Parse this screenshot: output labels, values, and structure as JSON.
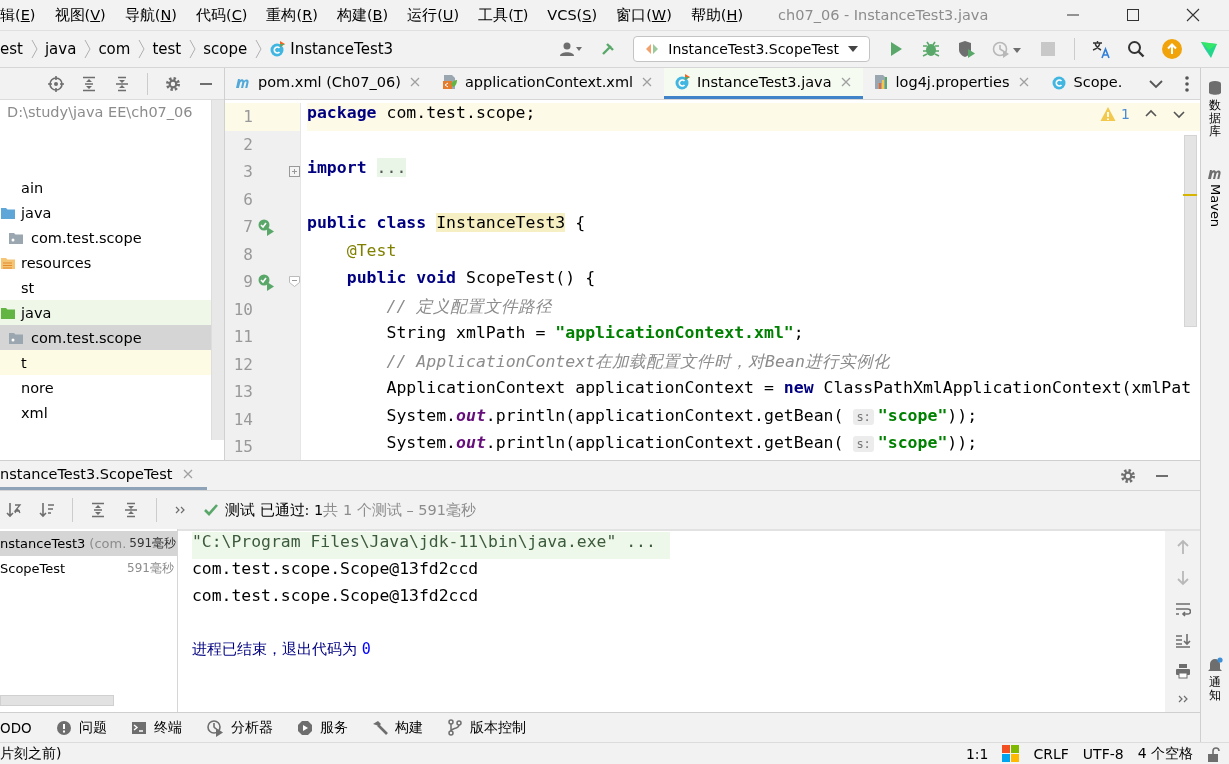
{
  "menu_bar": {
    "items": [
      "辑(E)",
      "视图(V)",
      "导航(N)",
      "代码(C)",
      "重构(R)",
      "构建(B)",
      "运行(U)",
      "工具(T)",
      "VCS(S)",
      "窗口(W)",
      "帮助(H)"
    ],
    "title": "ch07_06 - InstanceTest3.java"
  },
  "breadcrumbs": [
    {
      "label": "est",
      "kind": "folder"
    },
    {
      "label": "java",
      "kind": "folder"
    },
    {
      "label": "com",
      "kind": "folder"
    },
    {
      "label": "test",
      "kind": "folder"
    },
    {
      "label": "scope",
      "kind": "folder"
    },
    {
      "label": "InstanceTest3",
      "kind": "test-class"
    }
  ],
  "run_config": {
    "label": "InstanceTest3.ScopeTest"
  },
  "editor_tabs": [
    {
      "label": "pom.xml (Ch07_06)",
      "kind": "maven",
      "selected": false,
      "closable": true
    },
    {
      "label": "applicationContext.xml",
      "kind": "xml",
      "selected": false,
      "closable": true
    },
    {
      "label": "InstanceTest3.java",
      "kind": "test-class",
      "selected": true,
      "closable": true
    },
    {
      "label": "log4j.properties",
      "kind": "properties",
      "selected": false,
      "closable": true
    },
    {
      "label": "Scope.",
      "kind": "class",
      "selected": false,
      "closable": false
    }
  ],
  "project": {
    "path": "D:\\study\\java EE\\ch07_06",
    "tree": [
      {
        "label": "ain",
        "selected": false,
        "children": [
          {
            "label": "java",
            "kind": "source",
            "selected": false,
            "children": [
              {
                "label": "com.test.scope",
                "kind": "package",
                "selected": false
              }
            ]
          },
          {
            "label": "resources",
            "kind": "resources",
            "selected": false
          }
        ]
      },
      {
        "label": "st",
        "selected": false,
        "children": [
          {
            "label": "java",
            "kind": "test-source",
            "selected": false,
            "children": [
              {
                "label": "com.test.scope",
                "kind": "package",
                "selected": true
              }
            ]
          }
        ]
      },
      {
        "label": "t",
        "kind": "excluded",
        "selected": false
      },
      {
        "label": "nore",
        "selected": false
      },
      {
        "label": "xml",
        "selected": false
      }
    ]
  },
  "editor": {
    "warnings": "1",
    "lines": [
      {
        "number": "1",
        "current": true,
        "run_marker": false,
        "fold_marker": false,
        "tokens": [
          {
            "kind": "keyword",
            "text": "package"
          },
          {
            "kind": "plain",
            "text": " com.test.scope;"
          }
        ]
      },
      {
        "number": "2",
        "current": false,
        "run_marker": false,
        "fold_marker": false
      },
      {
        "number": "3",
        "current": false,
        "run_marker": false,
        "fold_marker": true,
        "folded": true,
        "tokens": [
          {
            "kind": "keyword",
            "text": "import "
          },
          {
            "kind": "folded",
            "text": "..."
          }
        ]
      },
      {
        "number": "6",
        "current": false,
        "run_marker": false,
        "fold_marker": false
      },
      {
        "number": "7",
        "current": false,
        "run_marker": true,
        "fold_marker": false,
        "tokens": [
          {
            "kind": "keyword",
            "text": "public class "
          },
          {
            "kind": "highlighted",
            "text": "InstanceTest3"
          },
          {
            "kind": "plain",
            "text": " {"
          }
        ]
      },
      {
        "number": "8",
        "current": false,
        "run_marker": false,
        "fold_marker": false,
        "tokens": [
          {
            "kind": "annotation",
            "text": "    @Test"
          }
        ]
      },
      {
        "number": "9",
        "current": false,
        "run_marker": true,
        "fold_marker": true,
        "folded": false,
        "tokens": [
          {
            "kind": "keyword",
            "text": "    public void"
          },
          {
            "kind": "plain",
            "text": " ScopeTest() {"
          }
        ]
      },
      {
        "number": "10",
        "current": false,
        "run_marker": false,
        "fold_marker": false,
        "tokens": [
          {
            "kind": "comment",
            "text": "        // 定义配置文件路径"
          }
        ]
      },
      {
        "number": "11",
        "current": false,
        "run_marker": false,
        "fold_marker": false,
        "tokens": [
          {
            "kind": "plain",
            "text": "        String xmlPath = "
          },
          {
            "kind": "string",
            "text": "\"applicationContext.xml\""
          },
          {
            "kind": "plain",
            "text": ";"
          }
        ]
      },
      {
        "number": "12",
        "current": false,
        "run_marker": false,
        "fold_marker": false,
        "tokens": [
          {
            "kind": "comment",
            "text": "        // ApplicationContext在加载配置文件时，对Bean进行实例化"
          }
        ]
      },
      {
        "number": "13",
        "current": false,
        "run_marker": false,
        "fold_marker": false,
        "tokens": [
          {
            "kind": "plain",
            "text": "        ApplicationContext applicationContext = "
          },
          {
            "kind": "keyword",
            "text": "new"
          },
          {
            "kind": "plain",
            "text": " ClassPathXmlApplicationContext(xmlPat"
          }
        ]
      },
      {
        "number": "14",
        "current": false,
        "run_marker": false,
        "fold_marker": false,
        "tokens": [
          {
            "kind": "plain",
            "text": "        System."
          },
          {
            "kind": "static",
            "text": "out"
          },
          {
            "kind": "plain",
            "text": ".println(applicationContext.getBean( "
          },
          {
            "kind": "hint",
            "text": "s:"
          },
          {
            "kind": "string",
            "text": " \"scope\""
          },
          {
            "kind": "plain",
            "text": "));"
          }
        ]
      },
      {
        "number": "15",
        "current": false,
        "run_marker": false,
        "fold_marker": false,
        "tokens": [
          {
            "kind": "plain",
            "text": "        System."
          },
          {
            "kind": "static",
            "text": "out"
          },
          {
            "kind": "plain",
            "text": ".println(applicationContext.getBean( "
          },
          {
            "kind": "hint",
            "text": "s:"
          },
          {
            "kind": "string",
            "text": " \"scope\""
          },
          {
            "kind": "plain",
            "text": "));"
          }
        ]
      }
    ]
  },
  "run_panel": {
    "tab": "nstanceTest3.ScopeTest",
    "passed": "测试 已通过: 1",
    "summary": "共 1 个测试 – 591毫秒",
    "tests": [
      {
        "label": "nstanceTest3",
        "detail": "(com.",
        "time": "591毫秒",
        "selected": true,
        "children": [
          {
            "label": "ScopeTest",
            "time": "591毫秒",
            "selected": false
          }
        ]
      }
    ],
    "console": [
      {
        "kind": "command",
        "text": "\"C:\\Program Files\\Java\\jdk-11\\bin\\java.exe\" ..."
      },
      {
        "kind": "output",
        "text": "com.test.scope.Scope@13fd2ccd"
      },
      {
        "kind": "output",
        "text": "com.test.scope.Scope@13fd2ccd"
      },
      {
        "kind": "exit",
        "text": "进程已结束，退出代码为 ",
        "code": "0"
      }
    ]
  },
  "tool_tabs": [
    {
      "label": "ODO"
    },
    {
      "label": "问题",
      "kind": "problems"
    },
    {
      "label": "终端",
      "kind": "terminal"
    },
    {
      "label": "分析器",
      "kind": "profiler"
    },
    {
      "label": "服务",
      "kind": "services"
    },
    {
      "label": "构建",
      "kind": "build"
    },
    {
      "label": "版本控制",
      "kind": "vcs"
    }
  ],
  "side_strip": {
    "top": [
      {
        "label": "数据库",
        "kind": "database"
      },
      {
        "label": "Maven",
        "kind": "maven"
      }
    ],
    "bottom": [
      {
        "label": "通知",
        "kind": "notifications"
      }
    ]
  },
  "status_bar": {
    "message": "片刻之前)",
    "position": "1:1",
    "line_separator": "CRLF",
    "encoding": "UTF-8",
    "indent": "4 个空格"
  }
}
